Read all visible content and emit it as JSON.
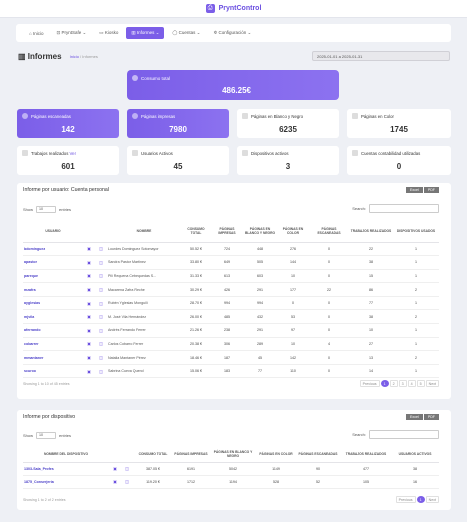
{
  "brand": {
    "name": "PryntControl"
  },
  "nav": [
    {
      "label": "Inicio",
      "icon": "home-icon"
    },
    {
      "label": "PryntSafe ⌄",
      "icon": "lock-icon"
    },
    {
      "label": "Kiosko",
      "icon": "monitor-icon"
    },
    {
      "label": "Informes ⌄",
      "icon": "chart-icon",
      "active": true
    },
    {
      "label": "Cuentas ⌄",
      "icon": "user-icon"
    },
    {
      "label": "Configuración ⌄",
      "icon": "gear-icon"
    }
  ],
  "header": {
    "title": "Informes",
    "crumb_home": "Inicio",
    "crumb_current": "Informes",
    "date_range": "2025-01-01 a 2025-01-31"
  },
  "hero": {
    "label": "Consumo total",
    "value": "486.25€"
  },
  "stats": [
    {
      "label": "Páginas escaneadas",
      "value": "142"
    },
    {
      "label": "Páginas impresas",
      "value": "7980"
    },
    {
      "label": "Páginas en Blanco y Negro",
      "value": "6235"
    },
    {
      "label": "Páginas en Color",
      "value": "1745"
    },
    {
      "label": "Trabajos realizados",
      "link": "Ver",
      "value": "601"
    },
    {
      "label": "Usuarios Activos",
      "value": "45"
    },
    {
      "label": "Dispositivos activos",
      "value": "3"
    },
    {
      "label": "Cuentas contabilidad utilizadas",
      "value": "0"
    }
  ],
  "users_table": {
    "title": "Informe por usuario: Cuenta personal",
    "buttons": [
      "Excel",
      "PDF"
    ],
    "show_label": "Show",
    "show_value": "10",
    "entries_label": "entries",
    "search_label": "Search:",
    "columns": [
      "USUARIO",
      "",
      "",
      "NOMBRE",
      "CONSUMO TOTAL",
      "PÁGINAS IMPRESAS",
      "PÁGINAS EN BLANCO Y NEGRO",
      "PÁGINAS EN COLOR",
      "PÁGINAS ESCANEADAS",
      "TRABAJOS REALIZADOS",
      "DISPOSITIVOS USADOS"
    ],
    "rows": [
      [
        "bdominguez",
        "▣",
        "◫",
        "Lourdes Dominguez Sotomayor",
        "50.52 €",
        "724",
        "448",
        "276",
        "0",
        "22",
        "1"
      ],
      [
        "apastor",
        "▣",
        "◫",
        "Sandra Pastor Martinez",
        "33.80 €",
        "649",
        "505",
        "144",
        "0",
        "38",
        "1"
      ],
      [
        "pareque",
        "▣",
        "◫",
        "Pili Requena Cebequedas S...",
        "31.33 €",
        "613",
        "603",
        "10",
        "0",
        "15",
        "1"
      ],
      [
        "mzafra",
        "▣",
        "◫",
        "Macarena Zafra Reche",
        "30.29 €",
        "426",
        "291",
        "177",
        "22",
        "86",
        "2"
      ],
      [
        "ayglesias",
        "▣",
        "◫",
        "Rubén Yglesias Monguilí",
        "28.70 €",
        "994",
        "994",
        "0",
        "0",
        "77",
        "1"
      ],
      [
        "mjvila",
        "▣",
        "◫",
        "M. José Vila Hernández",
        "26.00 €",
        "485",
        "432",
        "53",
        "0",
        "38",
        "2"
      ],
      [
        "aferrando",
        "▣",
        "◫",
        "Andrés Ferrando Ferrer",
        "21.26 €",
        "238",
        "291",
        "97",
        "0",
        "10",
        "1"
      ],
      [
        "cobarrer",
        "▣",
        "◫",
        "Carlos Cobarro Ferrer",
        "20.38 €",
        "306",
        "289",
        "10",
        "4",
        "27",
        "1"
      ],
      [
        "mmantaner",
        "▣",
        "◫",
        "Natalia Mantaner Pérez",
        "18.46 €",
        "187",
        "45",
        "142",
        "0",
        "13",
        "2"
      ],
      [
        "scuroo",
        "▣",
        "◫",
        "Sabrina Cueva Querol",
        "15.06 €",
        "183",
        "77",
        "110",
        "0",
        "14",
        "1"
      ]
    ],
    "footer": "Showing 1 to 10 of 45 entries",
    "pager": [
      "Previous",
      "1",
      "2",
      "3",
      "4",
      "5",
      "Next"
    ]
  },
  "devices_table": {
    "title": "Informe por dispositivo",
    "buttons": [
      "Excel",
      "PDF"
    ],
    "show_label": "Show",
    "show_value": "10",
    "entries_label": "entries",
    "search_label": "Search:",
    "columns": [
      "NOMBRE DEL DISPOSITIVO",
      "",
      "",
      "CONSUMO TOTAL",
      "PÁGINAS IMPRESAS",
      "PÁGINAS EN BLANCO Y NEGRO",
      "PÁGINAS EN COLOR",
      "PÁGINAS ESCANEADAS",
      "TRABAJOS REALIZADOS",
      "USUARIOS ACTIVOS"
    ],
    "rows": [
      [
        "1303-Sala_Profes",
        "▣",
        "◫",
        "387.05 €",
        "6191",
        "5042",
        "1149",
        "90",
        "477",
        "38"
      ],
      [
        "1875_Conserjeria",
        "▣",
        "◫",
        "119.20 €",
        "1712",
        "1194",
        "528",
        "52",
        "105",
        "16"
      ]
    ],
    "footer": "Showing 1 to 2 of 2 entries",
    "pager": [
      "Previous",
      "1",
      "Next"
    ]
  }
}
